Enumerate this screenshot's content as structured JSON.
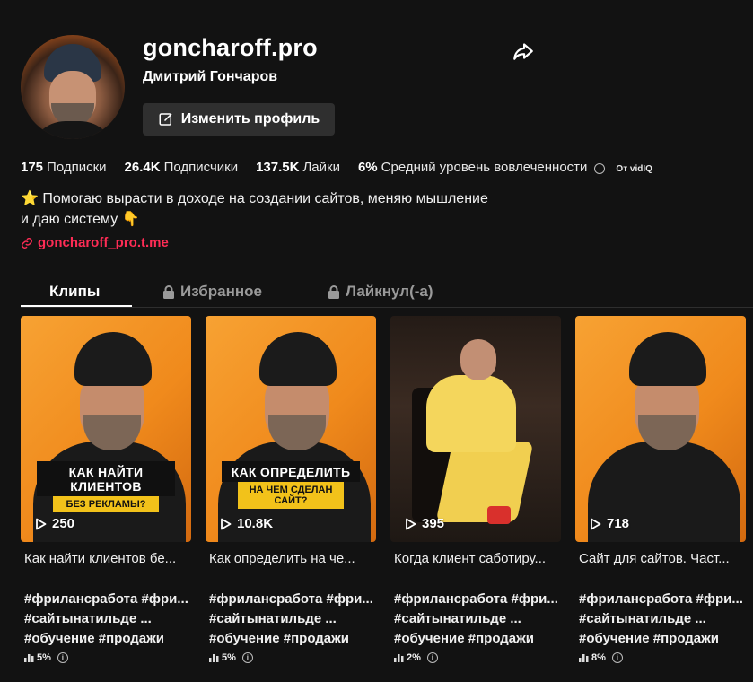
{
  "profile": {
    "username": "goncharoff.pro",
    "full_name": "Дмитрий Гончаров",
    "edit_label": "Изменить профиль"
  },
  "stats": {
    "following_count": "175",
    "following_label": "Подписки",
    "followers_count": "26.4K",
    "followers_label": "Подписчики",
    "likes_count": "137.5K",
    "likes_label": "Лайки",
    "engagement_value": "6%",
    "engagement_label": "Средний уровень вовлеченности",
    "engagement_source": "От vidIQ"
  },
  "bio": {
    "line1": "⭐ Помогаю вырасти в доходе на создании сайтов, меняю мышление",
    "line2": "и даю систему 👇",
    "link": "goncharoff_pro.t.me"
  },
  "tabs": [
    {
      "label": "Клипы",
      "active": true
    },
    {
      "label": "Избранное",
      "locked": true
    },
    {
      "label": "Лайкнул(-а)",
      "locked": true
    }
  ],
  "videos": [
    {
      "caption_top": "КАК НАЙТИ КЛИЕНТОВ",
      "caption_bottom": "БЕЗ РЕКЛАМЫ?",
      "views": "250",
      "title": "Как найти клиентов бе...",
      "tags_line1": "#фрилансработа #фри...",
      "tags_line2": "#сайтынатильде ...",
      "tags_line3": "#обучение #продажи",
      "engagement": "5%"
    },
    {
      "caption_top": "КАК ОПРЕДЕЛИТЬ",
      "caption_bottom": "НА ЧЕМ СДЕЛАН САЙТ?",
      "views": "10.8K",
      "title": "Как определить на че...",
      "tags_line1": "#фрилансработа #фри...",
      "tags_line2": "#сайтынатильде ...",
      "tags_line3": "#обучение #продажи",
      "engagement": "5%"
    },
    {
      "views": "395",
      "title": "Когда клиент саботиру...",
      "tags_line1": "#фрилансработа #фри...",
      "tags_line2": "#сайтынатильде ...",
      "tags_line3": "#обучение #продажи",
      "engagement": "2%"
    },
    {
      "views": "718",
      "title": "Сайт для сайтов. Част...",
      "tags_line1": "#фрилансработа #фри...",
      "tags_line2": "#сайтынатильде ...",
      "tags_line3": "#обучение #продажи",
      "engagement": "8%"
    }
  ],
  "colors": {
    "background": "#121212",
    "accent_link": "#fe2c55",
    "thumb_orange": "#f08a1c",
    "caption_yellow": "#f2c21a"
  }
}
